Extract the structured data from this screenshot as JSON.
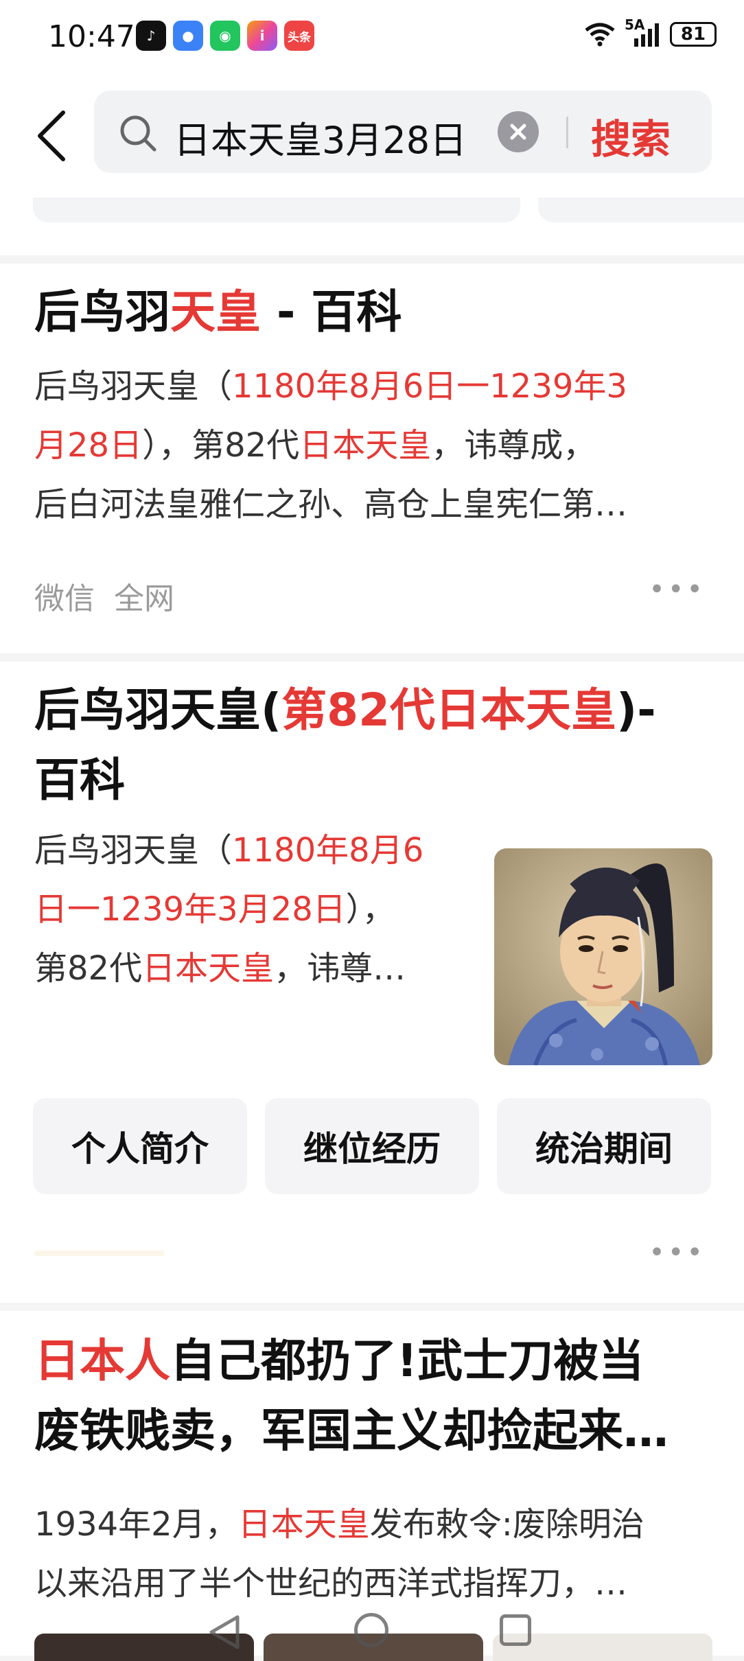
{
  "status_bar": {
    "time": "10:47",
    "network": "5A",
    "battery": "81"
  },
  "app_icons": [
    "tiktok-icon",
    "message-icon",
    "wechat-icon",
    "instagram-icon",
    "toutiao-icon"
  ],
  "app_icon_labels": {
    "toutiao": "头条"
  },
  "search": {
    "query": "日本天皇3月28日",
    "button": "搜索"
  },
  "results": [
    {
      "title": [
        {
          "t": "后鸟羽",
          "hl": false
        },
        {
          "t": "天皇",
          "hl": true
        },
        {
          "t": " - 百科",
          "hl": false
        }
      ],
      "snippet_lines": [
        [
          {
            "t": "后鸟羽天皇（",
            "hl": false
          },
          {
            "t": "1180年8月6日一1239年3",
            "hl": true
          }
        ],
        [
          {
            "t": "月28日",
            "hl": true
          },
          {
            "t": "），第82代",
            "hl": false
          },
          {
            "t": "日本天皇",
            "hl": true
          },
          {
            "t": "，讳尊成，",
            "hl": false
          }
        ],
        [
          {
            "t": "后白河法皇雅仁之孙、高仓上皇宪仁第…",
            "hl": false
          }
        ]
      ],
      "meta": "微信  全网",
      "more": "•••"
    },
    {
      "title_lines": [
        [
          {
            "t": "后鸟羽天皇(",
            "hl": false
          },
          {
            "t": "第82代日本天皇",
            "hl": true
          },
          {
            "t": ")-",
            "hl": false
          }
        ],
        [
          {
            "t": "百科",
            "hl": false
          }
        ]
      ],
      "snippet_lines": [
        [
          {
            "t": "后鸟羽天皇（",
            "hl": false
          },
          {
            "t": "1180年8月6",
            "hl": true
          }
        ],
        [
          {
            "t": "日一1239年3月28日",
            "hl": true
          },
          {
            "t": "），",
            "hl": false
          }
        ],
        [
          {
            "t": "第82代",
            "hl": false
          },
          {
            "t": "日本天皇",
            "hl": true
          },
          {
            "t": "，讳尊…",
            "hl": false
          }
        ]
      ],
      "image": "emperor-portrait",
      "tabs": [
        "个人简介",
        "继位经历",
        "统治期间"
      ],
      "more": "•••"
    },
    {
      "title_lines": [
        [
          {
            "t": "日本人",
            "hl": true
          },
          {
            "t": "自己都扔了!武士刀被当",
            "hl": false
          }
        ],
        [
          {
            "t": "废铁贱卖，军国主义却捡起来…",
            "hl": false
          }
        ]
      ],
      "snippet_lines": [
        [
          {
            "t": "1934年2月，",
            "hl": false
          },
          {
            "t": "日本天皇",
            "hl": true
          },
          {
            "t": "发布敕令:废除明治",
            "hl": false
          }
        ],
        [
          {
            "t": "以来沿用了半个世纪的西洋式指挥刀，…",
            "hl": false
          }
        ]
      ]
    }
  ],
  "colors": {
    "highlight": "#e53935",
    "meta": "#9a9a9a"
  }
}
